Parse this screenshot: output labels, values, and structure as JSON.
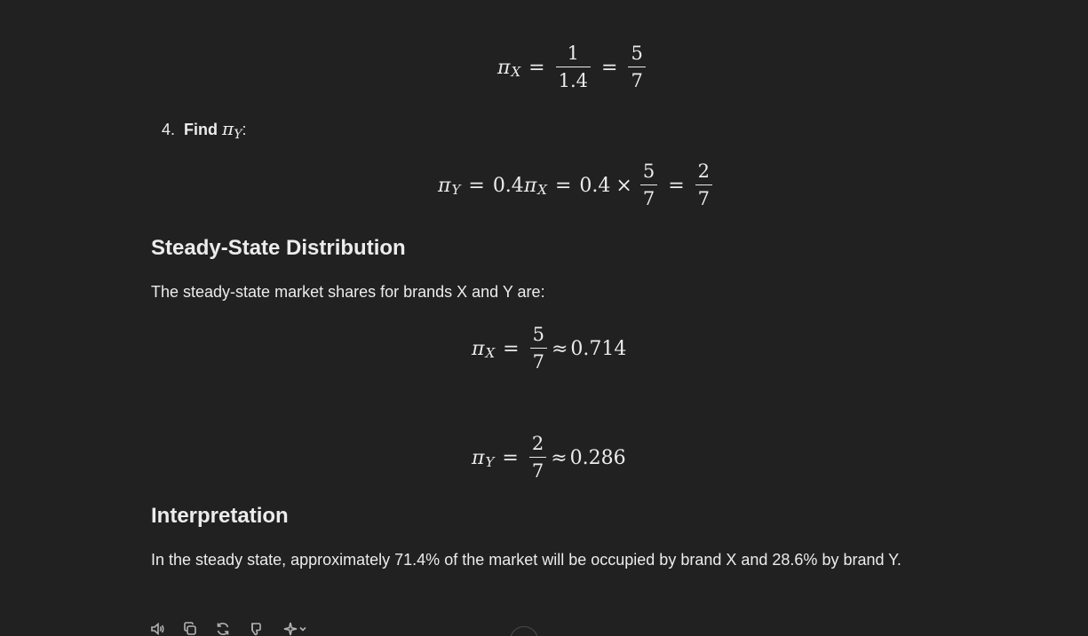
{
  "math": {
    "pi": "π",
    "sub_x": "X",
    "sub_y": "Y",
    "eq": "=",
    "approx": "≈",
    "times": "×",
    "coef": "0.4",
    "one": "1",
    "one_point_four": "1.4",
    "five": "5",
    "seven": "7",
    "two": "2",
    "val_x": "0.714",
    "val_y": "0.286"
  },
  "step4": {
    "number": "4.",
    "label": "Find",
    "suffix": ":"
  },
  "section_steady": {
    "title": "Steady-State Distribution",
    "intro": "The steady-state market shares for brands X and Y are:"
  },
  "section_interp": {
    "title": "Interpretation",
    "body": "In the steady state, approximately 71.4% of the market will be occupied by brand X and 28.6% by brand Y."
  },
  "toolbar": {
    "icons": [
      "speaker-icon",
      "copy-icon",
      "regenerate-icon",
      "thumbs-down-icon",
      "sparkle-icon",
      "chevron-down-icon"
    ]
  }
}
